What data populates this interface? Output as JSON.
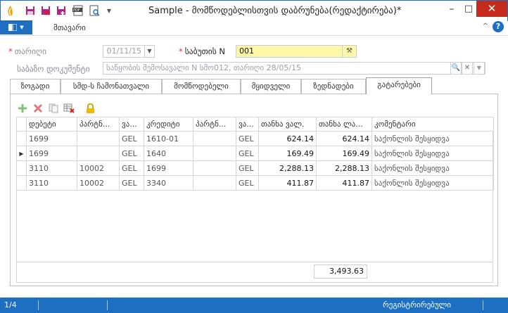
{
  "window": {
    "title": "Sample - მომწოდებლისთვის დაბრუნება(რედაქტირება)*",
    "minimize": "–",
    "maximize": "□",
    "close": "✕"
  },
  "menu": {
    "main_tab": "მთავარი",
    "help": "?",
    "collapse": "^"
  },
  "form": {
    "date_label": "თარიღი",
    "date_value": "01/11/15",
    "docnum_label": "საბუთის N",
    "docnum_value": "001",
    "base_doc_label": "საბაზო დოკუმენტი",
    "base_doc_value": "საწყობის შემოსავალი N სშო012, თარიღი  28/05/15"
  },
  "tabs": [
    {
      "label": "ზოგადი"
    },
    {
      "label": "სმდ-ს ჩამონათვალი"
    },
    {
      "label": "მომწოდებელი"
    },
    {
      "label": "მყიდველი"
    },
    {
      "label": "ზედნადები"
    },
    {
      "label": "გატარებები",
      "active": true
    }
  ],
  "toolbar_icons": [
    "add-icon",
    "delete-icon",
    "copy-icon",
    "clear-grid-icon",
    "lock-icon"
  ],
  "grid": {
    "columns": [
      "დებეტი",
      "პარტნ...",
      "ვა...",
      "კრედიტი",
      "პარტნ...",
      "ვა...",
      "თანხა ვალ.",
      "თანხა ლა...",
      "კომენტარი"
    ],
    "rows": [
      {
        "debit": "1699",
        "partner1": "",
        "cur1": "GEL",
        "credit": "1610-01",
        "partner2": "",
        "cur2": "GEL",
        "amount_cur": "624.14",
        "amount_gel": "624.14",
        "comment": "საქონლის შესყიდვა",
        "current": false
      },
      {
        "debit": "1699",
        "partner1": "",
        "cur1": "GEL",
        "credit": "1640",
        "partner2": "",
        "cur2": "GEL",
        "amount_cur": "169.49",
        "amount_gel": "169.49",
        "comment": "საქონლის შესყიდვა",
        "current": true
      },
      {
        "debit": "3110",
        "partner1": "10002",
        "cur1": "GEL",
        "credit": "1699",
        "partner2": "",
        "cur2": "GEL",
        "amount_cur": "2,288.13",
        "amount_gel": "2,288.13",
        "comment": "საქონლის შესყიდვა",
        "current": false
      },
      {
        "debit": "3110",
        "partner1": "10002",
        "cur1": "GEL",
        "credit": "3340",
        "partner2": "",
        "cur2": "GEL",
        "amount_cur": "411.87",
        "amount_gel": "411.87",
        "comment": "საქონლის შესყიდვა",
        "current": false
      }
    ],
    "total": "3,493.63"
  },
  "status": {
    "record": "1/4",
    "state": "რეგისტრირებული"
  },
  "colors": {
    "accent": "#1e6fc1",
    "required": "#e0312b",
    "docnum_bg": "#fff7a8",
    "close": "#c42b1c"
  }
}
